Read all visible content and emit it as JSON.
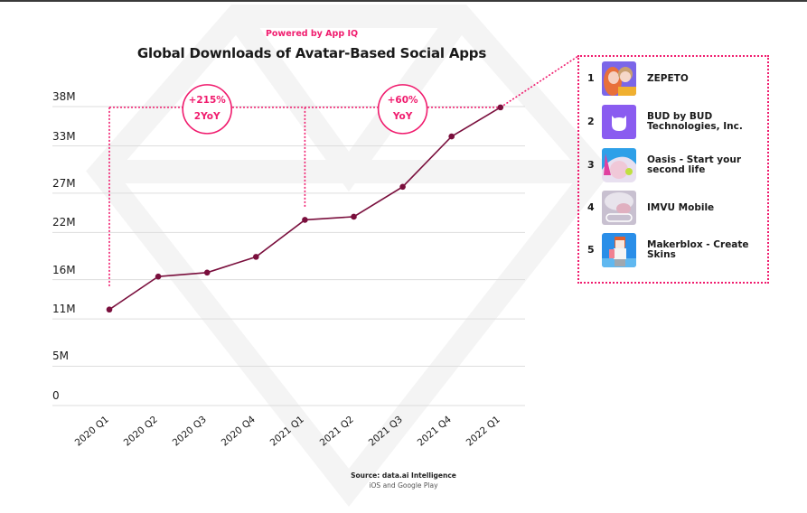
{
  "header": {
    "powered_by": "Powered by App IQ",
    "title": "Global Downloads of Avatar-Based Social Apps"
  },
  "colors": {
    "accent": "#f01c6e",
    "line": "#7a0f3d",
    "grid": "#dddddd",
    "text": "#1a1a1a"
  },
  "chart_data": {
    "type": "line",
    "title": "Global Downloads of Avatar-Based Social Apps",
    "subtitle": "Powered by App IQ",
    "xlabel": "",
    "ylabel": "",
    "categories": [
      "2020 Q1",
      "2020 Q2",
      "2020 Q3",
      "2020 Q4",
      "2021 Q1",
      "2021 Q2",
      "2021 Q3",
      "2021 Q4",
      "2022 Q1"
    ],
    "series": [
      {
        "name": "Global Downloads",
        "values": [
          12.2,
          16.4,
          16.9,
          18.9,
          23.6,
          24.0,
          27.8,
          34.2,
          37.9
        ]
      }
    ],
    "y_ticks": [
      0,
      5,
      11,
      16,
      22,
      27,
      33,
      38
    ],
    "y_tick_labels": [
      "0",
      "5M",
      "11M",
      "16M",
      "22M",
      "27M",
      "33M",
      "38M"
    ],
    "ylim": [
      0,
      38
    ],
    "grid": true,
    "legend": "right",
    "annotations": [
      {
        "line1": "+215%",
        "line2": "2YoY",
        "from": "2020 Q1",
        "to": "2022 Q1"
      },
      {
        "line1": "+60%",
        "line2": "YoY",
        "from": "2021 Q1",
        "to": "2022 Q1"
      }
    ],
    "source": "Source: data.ai Intelligence",
    "source_note": "iOS and Google Play"
  },
  "ranking": [
    {
      "rank": "1",
      "name": "ZEPETO",
      "icon": "zepeto-app-icon"
    },
    {
      "rank": "2",
      "name": "BUD by BUD Technologies, Inc.",
      "icon": "bud-app-icon"
    },
    {
      "rank": "3",
      "name": "Oasis - Start your second life",
      "icon": "oasis-app-icon"
    },
    {
      "rank": "4",
      "name": "IMVU Mobile",
      "icon": "imvu-app-icon"
    },
    {
      "rank": "5",
      "name": "Makerblox - Create Skins",
      "icon": "makerblox-app-icon"
    }
  ]
}
